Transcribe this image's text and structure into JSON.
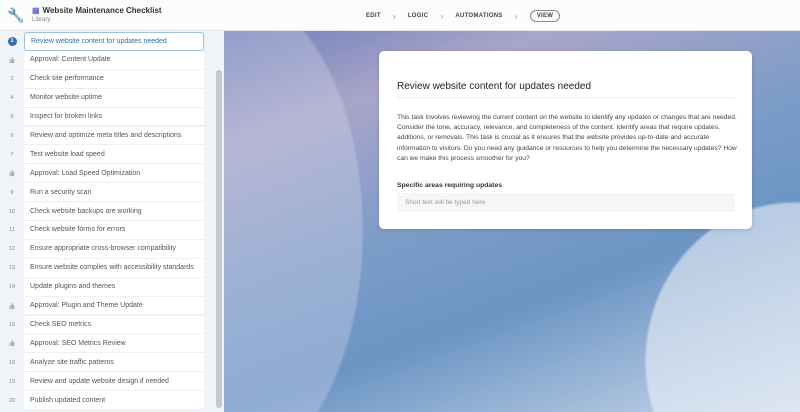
{
  "header": {
    "title": "Website Maintenance Checklist",
    "subtitle": "Library",
    "steps": [
      "EDIT",
      "LOGIC",
      "AUTOMATIONS",
      "VIEW"
    ],
    "active_step": "VIEW"
  },
  "sidebar": {
    "items": [
      {
        "marker": "1",
        "label": "Review website content for updates needed",
        "active": true
      },
      {
        "marker": "thumbs-up-icon",
        "label": "Approval: Content Update"
      },
      {
        "marker": "3",
        "label": "Check site performance"
      },
      {
        "marker": "4",
        "label": "Monitor website uptime"
      },
      {
        "marker": "5",
        "label": "Inspect for broken links"
      },
      {
        "marker": "6",
        "label": "Review and optimize meta titles and descriptions"
      },
      {
        "marker": "7",
        "label": "Test website load speed"
      },
      {
        "marker": "thumbs-up-icon",
        "label": "Approval: Load Speed Optimization"
      },
      {
        "marker": "9",
        "label": "Run a security scan"
      },
      {
        "marker": "10",
        "label": "Check website backups are working"
      },
      {
        "marker": "11",
        "label": "Check website forms for errors"
      },
      {
        "marker": "12",
        "label": "Ensure appropriate cross-browser compatibility"
      },
      {
        "marker": "13",
        "label": "Ensure website complies with accessibility standards"
      },
      {
        "marker": "14",
        "label": "Update plugins and themes"
      },
      {
        "marker": "thumbs-up-icon",
        "label": "Approval: Plugin and Theme Update"
      },
      {
        "marker": "16",
        "label": "Check SEO metrics"
      },
      {
        "marker": "thumbs-up-icon",
        "label": "Approval: SEO Metrics Review"
      },
      {
        "marker": "18",
        "label": "Analyze site traffic patterns"
      },
      {
        "marker": "19",
        "label": "Review and update website design if needed"
      },
      {
        "marker": "20",
        "label": "Publish updated content"
      }
    ]
  },
  "task": {
    "title": "Review website content for updates needed",
    "description": "This task involves reviewing the current content on the website to identify any updates or changes that are needed. Consider the tone, accuracy, relevance, and completeness of the content. Identify areas that require updates, additions, or removals. This task is crucial as it ensures that the website provides up-to-date and accurate information to visitors. Do you need any guidance or resources to help you determine the necessary updates? How can we make this process smoother for you?",
    "field_label": "Specific areas requiring updates",
    "field_value": "",
    "field_placeholder": "Short text will be typed here"
  },
  "colors": {
    "accent": "#2f6fb0"
  }
}
